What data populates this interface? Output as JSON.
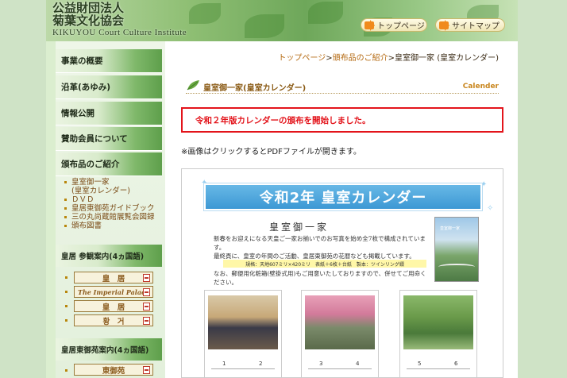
{
  "header": {
    "org_name_line1": "公益財団法人",
    "org_name_line2": "菊葉文化協会",
    "org_name_en": "KIKUYOU Court Culture Institute",
    "top_page_label": "トップページ",
    "sitemap_label": "サイトマップ"
  },
  "sidebar": {
    "items": [
      {
        "label": "事業の概要"
      },
      {
        "label": "沿革(あゆみ)"
      },
      {
        "label": "情報公開"
      },
      {
        "label": "賛助会員について"
      },
      {
        "label": "頒布品のご紹介"
      }
    ],
    "sub_items": [
      {
        "label": "皇室御一家"
      },
      {
        "label": "(皇室カレンダー)"
      },
      {
        "label": "ＤＶＤ"
      },
      {
        "label": "皇居東御苑ガイドブック"
      },
      {
        "label": "三の丸尚蔵館展覧会図録"
      },
      {
        "label": "頒布図書"
      }
    ],
    "section1_title": "皇居 参観案内(4ヵ国語)",
    "section1_buttons": [
      "皇　居",
      "The Imperial Palace",
      "皇　居",
      "황　거"
    ],
    "section2_title": "皇居東御苑案内(4ヵ国語)",
    "section2_buttons": [
      "東御苑"
    ]
  },
  "main": {
    "breadcrumb": {
      "top": "トップページ",
      "sep1": ">",
      "category": "頒布品のご紹介",
      "sep2": ">",
      "current": "皇室御一家 (皇室カレンダー)"
    },
    "title": "皇室御一家(皇室カレンダー)",
    "title_en": "Calender",
    "notice": "令和２年版カレンダーの頒布を開始しました。",
    "note": "※画像はクリックするとPDFファイルが開きます。",
    "calendar": {
      "banner": "令和2年 皇室カレンダー",
      "heading": "皇室御一家",
      "desc1": "新春をお迎えになる天皇ご一家お揃いでのお写真を始め全7枚で構成されています。",
      "desc2": "最終頁に、皇室の年間のご活動、皇居東御苑の花暦なども掲載しています。",
      "spec": "規格：天地607ミリ×420ミリ　表紙＋6枚＋台紙　製本：ツインリング綴",
      "desc3": "なお、郵便用化粧箱(壁掛式用)もご用意いたしておりますので、併せてご用命ください。",
      "cover_caption": "皇室御一家",
      "months": [
        {
          "a": "1",
          "b": "2"
        },
        {
          "a": "3",
          "b": "4"
        },
        {
          "a": "5",
          "b": "6"
        }
      ]
    }
  },
  "colors": {
    "accent_red": "#e3141b",
    "link_brown": "#b56a12",
    "menu_green": "#5e9f4b",
    "banner_blue": "#3d98d4"
  }
}
